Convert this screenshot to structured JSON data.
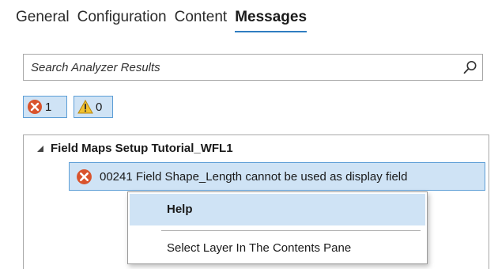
{
  "tabs": [
    {
      "label": "General",
      "active": false
    },
    {
      "label": "Configuration",
      "active": false
    },
    {
      "label": "Content",
      "active": false
    },
    {
      "label": "Messages",
      "active": true
    }
  ],
  "search": {
    "placeholder": "Search Analyzer Results",
    "value": "",
    "icon": "search-icon"
  },
  "filters": {
    "errors": {
      "count": "1",
      "icon": "error-icon",
      "color": "#d9532c"
    },
    "warnings": {
      "count": "0",
      "icon": "warning-icon",
      "color": "#f2c230"
    }
  },
  "results": {
    "layer_name": "Field Maps Setup Tutorial_WFL1",
    "messages": [
      {
        "text": "00241 Field Shape_Length cannot be used as display field",
        "severity": "error",
        "icon": "error-icon"
      }
    ]
  },
  "context_menu": {
    "items": [
      {
        "label": "Help"
      },
      {
        "label": "Select Layer In The Contents Pane"
      }
    ]
  },
  "colors": {
    "accent": "#2f7dc1",
    "selection": "#cfe3f5",
    "selection_border": "#5d9ed6",
    "error": "#d9532c",
    "warning": "#f2c230"
  }
}
